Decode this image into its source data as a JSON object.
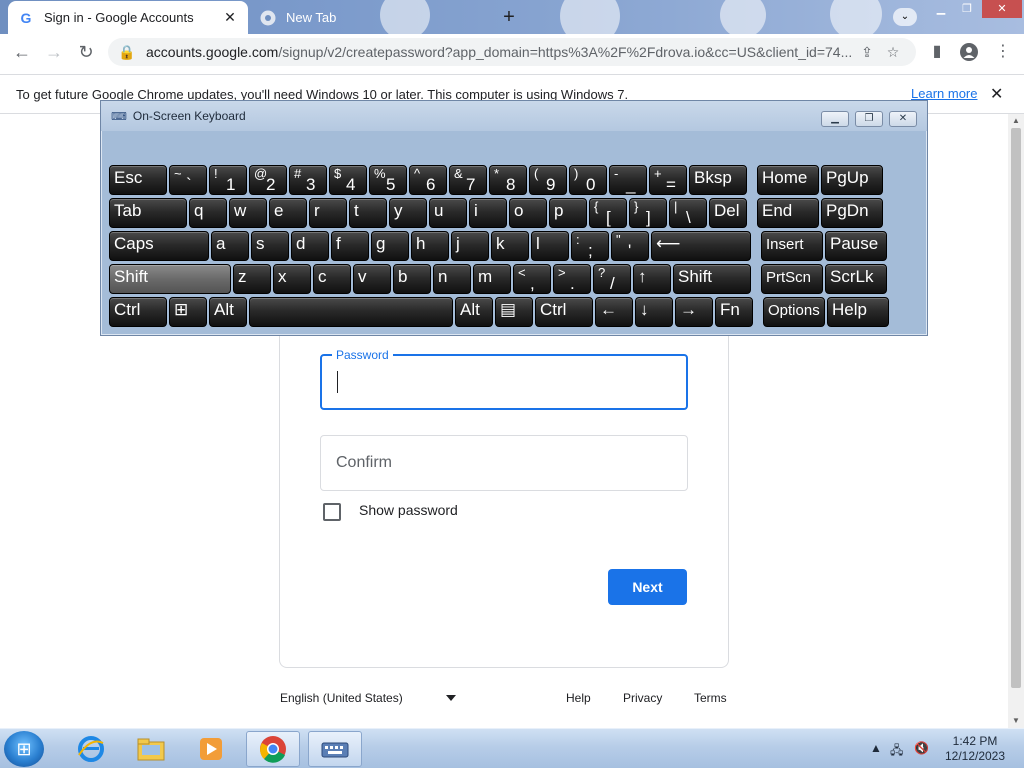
{
  "browser": {
    "tabs": [
      {
        "title": "Sign in - Google Accounts",
        "favicon": "google-icon",
        "active": true
      },
      {
        "title": "New Tab",
        "favicon": "chrome-icon",
        "active": false
      }
    ],
    "url_host": "accounts.google.com",
    "url_path": "/signup/v2/createpassword?app_domain=https%3A%2F%2Fdrova.io&cc=US&client_id=74..."
  },
  "infobar": {
    "message": "To get future Google Chrome updates, you'll need Windows 10 or later. This computer is using Windows 7.",
    "link": "Learn more"
  },
  "form": {
    "password_label": "Password",
    "password_value": "",
    "confirm_placeholder": "Confirm",
    "show_password_label": "Show password",
    "show_password_checked": false,
    "next_label": "Next"
  },
  "footer": {
    "language": "English (United States)",
    "help": "Help",
    "privacy": "Privacy",
    "terms": "Terms"
  },
  "osk": {
    "title": "On-Screen Keyboard",
    "rows": [
      [
        {
          "main": "Esc"
        },
        {
          "sub": "~",
          "main": "`"
        },
        {
          "sub": "!",
          "main": "1"
        },
        {
          "sub": "@",
          "main": "2"
        },
        {
          "sub": "#",
          "main": "3"
        },
        {
          "sub": "$",
          "main": "4"
        },
        {
          "sub": "%",
          "main": "5"
        },
        {
          "sub": "^",
          "main": "6"
        },
        {
          "sub": "&",
          "main": "7"
        },
        {
          "sub": "*",
          "main": "8"
        },
        {
          "sub": "(",
          "main": "9"
        },
        {
          "sub": ")",
          "main": "0"
        },
        {
          "sub": "-",
          "main": "_"
        },
        {
          "sub": "+",
          "main": "="
        },
        {
          "main": "Bksp"
        },
        {
          "main": "Home"
        },
        {
          "main": "PgUp"
        }
      ],
      [
        {
          "main": "Tab"
        },
        {
          "main": "q"
        },
        {
          "main": "w"
        },
        {
          "main": "e"
        },
        {
          "main": "r"
        },
        {
          "main": "t"
        },
        {
          "main": "y"
        },
        {
          "main": "u"
        },
        {
          "main": "i"
        },
        {
          "main": "o"
        },
        {
          "main": "p"
        },
        {
          "sub": "{",
          "main": "["
        },
        {
          "sub": "}",
          "main": "]"
        },
        {
          "sub": "|",
          "main": "\\"
        },
        {
          "main": "Del"
        },
        {
          "main": "End"
        },
        {
          "main": "PgDn"
        }
      ],
      [
        {
          "main": "Caps"
        },
        {
          "main": "a"
        },
        {
          "main": "s"
        },
        {
          "main": "d"
        },
        {
          "main": "f"
        },
        {
          "main": "g"
        },
        {
          "main": "h"
        },
        {
          "main": "j"
        },
        {
          "main": "k"
        },
        {
          "main": "l"
        },
        {
          "sub": ":",
          "main": ";"
        },
        {
          "sub": "\"",
          "main": "'"
        },
        {
          "main": "⟵"
        },
        {
          "main": "Insert"
        },
        {
          "main": "Pause"
        }
      ],
      [
        {
          "main": "Shift",
          "active": true
        },
        {
          "main": "z"
        },
        {
          "main": "x"
        },
        {
          "main": "c"
        },
        {
          "main": "v"
        },
        {
          "main": "b"
        },
        {
          "main": "n"
        },
        {
          "main": "m"
        },
        {
          "sub": "<",
          "main": ","
        },
        {
          "sub": ">",
          "main": "."
        },
        {
          "sub": "?",
          "main": "/"
        },
        {
          "main": "↑"
        },
        {
          "main": "Shift"
        },
        {
          "main": "PrtScn"
        },
        {
          "main": "ScrLk"
        }
      ],
      [
        {
          "main": "Ctrl"
        },
        {
          "main": "⊞"
        },
        {
          "main": "Alt"
        },
        {
          "main": ""
        },
        {
          "main": "Alt"
        },
        {
          "main": "▤"
        },
        {
          "main": "Ctrl"
        },
        {
          "main": "←"
        },
        {
          "main": "↓"
        },
        {
          "main": "→"
        },
        {
          "main": "Fn"
        },
        {
          "main": "Options"
        },
        {
          "main": "Help"
        }
      ]
    ]
  },
  "taskbar": {
    "items": [
      "internet-explorer-icon",
      "file-explorer-icon",
      "media-player-icon",
      "chrome-icon",
      "on-screen-keyboard-icon"
    ],
    "time": "1:42 PM",
    "date": "12/12/2023"
  }
}
